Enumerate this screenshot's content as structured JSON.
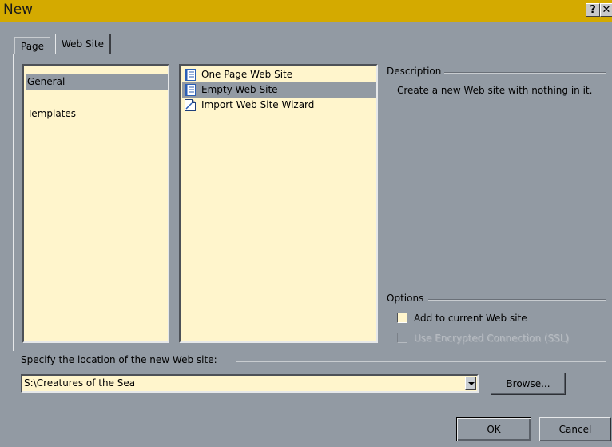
{
  "window": {
    "title": "New",
    "help_label": "?",
    "close_label": "✕"
  },
  "tabs": [
    {
      "label": "Page",
      "selected": false
    },
    {
      "label": "Web Site",
      "selected": true
    }
  ],
  "categories": [
    {
      "label": "General",
      "selected": true
    },
    {
      "label": "Templates",
      "selected": false
    }
  ],
  "templates": [
    {
      "label": "One Page Web Site",
      "icon": "page-lines-icon",
      "selected": false
    },
    {
      "label": "Empty Web Site",
      "icon": "page-lines-icon",
      "selected": true
    },
    {
      "label": "Import Web Site Wizard",
      "icon": "wizard-page-icon",
      "selected": false
    }
  ],
  "description": {
    "group_label": "Description",
    "text": "Create a new Web site with nothing in it."
  },
  "options": {
    "group_label": "Options",
    "add_to_current": {
      "label": "Add to current Web site",
      "checked": false,
      "enabled": true
    },
    "use_ssl": {
      "label": "Use Encrypted Connection (SSL)",
      "checked": false,
      "enabled": false
    }
  },
  "location": {
    "group_label": "Specify the location of the new Web site:",
    "value": "S:\\Creatures of the Sea"
  },
  "buttons": {
    "browse": "Browse...",
    "ok": "OK",
    "cancel": "Cancel"
  },
  "colors": {
    "title_bar": "#d4aa00",
    "dialog_bg": "#929aa3",
    "list_bg": "#fff5cc",
    "selection": "#929aa3"
  }
}
